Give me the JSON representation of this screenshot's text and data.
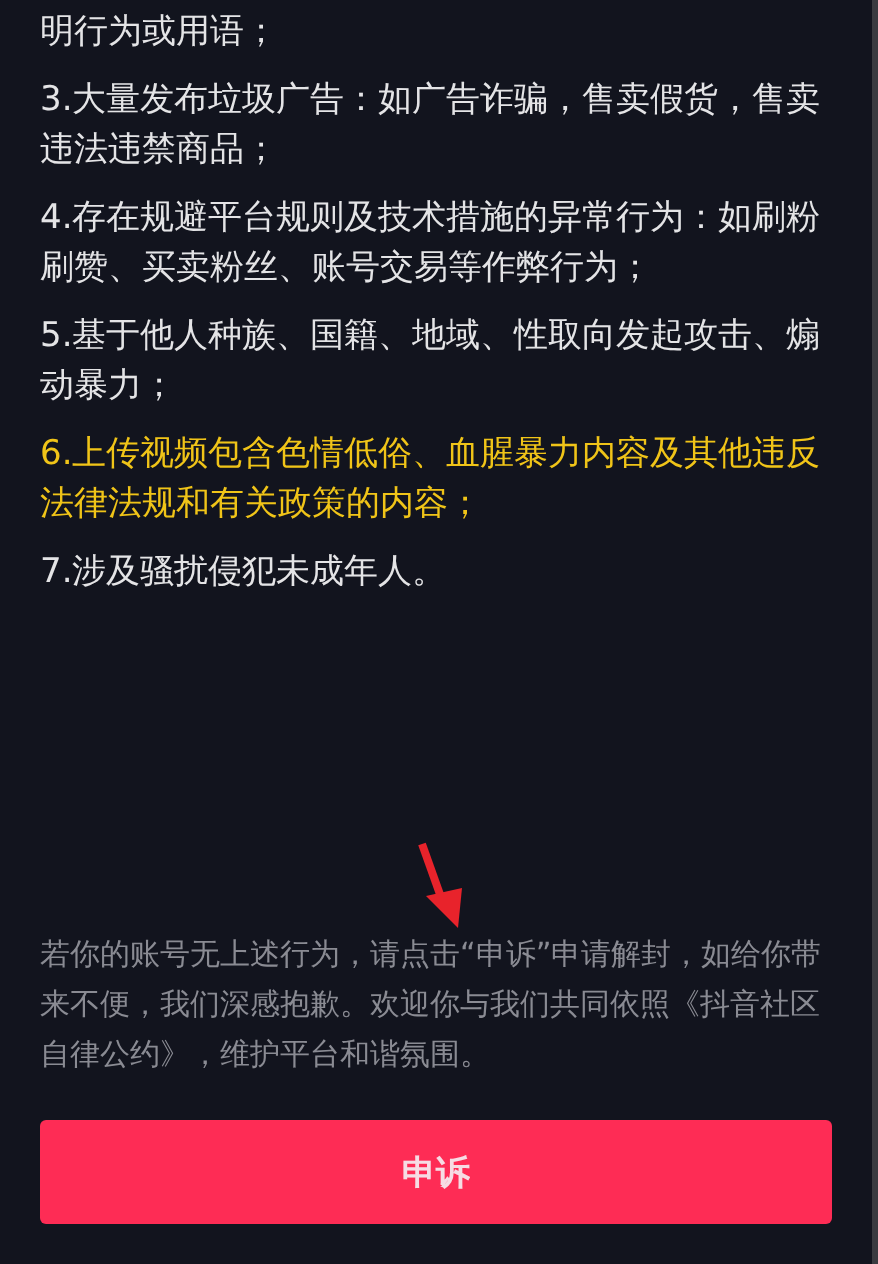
{
  "rules": [
    {
      "text": "明行为或用语；",
      "highlighted": false
    },
    {
      "text": "3.大量发布垃圾广告：如广告诈骗，售卖假货，售卖违法违禁商品；",
      "highlighted": false
    },
    {
      "text": "4.存在规避平台规则及技术措施的异常行为：如刷粉刷赞、买卖粉丝、账号交易等作弊行为；",
      "highlighted": false
    },
    {
      "text": "5.基于他人种族、国籍、地域、性取向发起攻击、煽动暴力；",
      "highlighted": false
    },
    {
      "text": "6.上传视频包含色情低俗、血腥暴力内容及其他违反法律法规和有关政策的内容；",
      "highlighted": true
    },
    {
      "text": "7.涉及骚扰侵犯未成年人。",
      "highlighted": false
    }
  ],
  "notice": "若你的账号无上述行为，请点击“申诉”申请解封，如给你带来不便，我们深感抱歉。欢迎你与我们共同依照《抖音社区自律公约》，维护平台和谐氛围。",
  "appeal_button": {
    "label": "申诉"
  }
}
